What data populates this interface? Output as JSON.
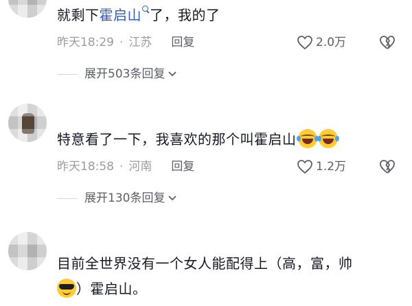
{
  "comments": [
    {
      "text_before": "就剩下",
      "highlight": "霍启山",
      "text_after": "了，我的了",
      "time": "昨天18:29",
      "location": "江苏",
      "reply_label": "回复",
      "likes": "2.0万",
      "expand_label": "展开503条回复"
    },
    {
      "text": "特意看了一下，我喜欢的那个叫霍启山",
      "time": "昨天18:58",
      "location": "河南",
      "reply_label": "回复",
      "likes": "1.2万",
      "expand_label": "展开130条回复"
    },
    {
      "line1": "目前全世界没有一个女人能配得上（高，富，帅",
      "line2": "）霍启山。"
    }
  ],
  "separator": "·",
  "colors": {
    "link": "#2d5ec1",
    "text": "#161823",
    "meta": "#9a9ca3"
  },
  "icons": [
    "search-icon",
    "heart-icon",
    "broken-heart-icon",
    "chevron-down-icon",
    "laughing-emoji-icon",
    "cool-emoji-icon"
  ]
}
